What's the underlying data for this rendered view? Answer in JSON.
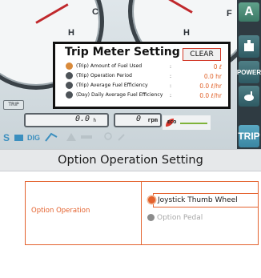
{
  "monitor": {
    "gauges": [
      {
        "letter": "H"
      },
      {
        "letter": "C"
      },
      {
        "letter": "H"
      },
      {
        "letter": "F"
      }
    ],
    "trip_label": "TRIP",
    "hours_value": "0.0",
    "hours_unit": "h",
    "rpm_value": "0",
    "rpm_unit": "rpm",
    "eco_label": "ECO",
    "right_buttons": [
      "A",
      "",
      "POWER",
      "",
      "TRIP"
    ],
    "status_icons": [
      "S",
      "DIG"
    ]
  },
  "trip_popup": {
    "title": "Trip Meter Setting",
    "clear_label": "CLEAR",
    "rows": [
      {
        "label": "(Trip) Amount of Fuel Used",
        "value": "0 ℓ",
        "selected": true
      },
      {
        "label": "(Trip) Operation Period",
        "value": "0.0 hr",
        "selected": false
      },
      {
        "label": "(Trip) Average Fuel Efficiency",
        "value": "0.0 ℓ/hr",
        "selected": false
      },
      {
        "label": "(Day) Daily Average Fuel Efficiency",
        "value": "0.0 ℓ/hr",
        "selected": false
      }
    ]
  },
  "option_panel": {
    "title": "Option Operation Setting",
    "row_label": "Option Operation",
    "choices": [
      {
        "label": "Joystick Thumb Wheel",
        "selected": true
      },
      {
        "label": "Option Pedal",
        "selected": false
      }
    ]
  },
  "colors": {
    "accent": "#e4622e",
    "value_orange": "#e0622a",
    "frame_dark": "#2f3b42",
    "needle_red": "#c0282c"
  }
}
